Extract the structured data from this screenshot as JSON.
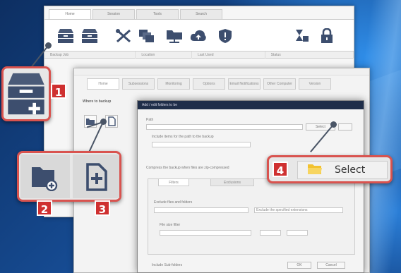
{
  "main_window": {
    "tabs": [
      "Home",
      "Session",
      "Tools",
      "Search"
    ],
    "columns": [
      "Backup Job",
      "Location",
      "Last Used",
      "Status"
    ]
  },
  "backup_window": {
    "tabs": [
      "Home",
      "Subsessions",
      "Monitoring",
      "Options",
      "Email Notifications",
      "Other Computer",
      "Version"
    ],
    "section_label": "Where to backup"
  },
  "dialog": {
    "title": "Add / edit folders to be",
    "path_label": "Path",
    "description_label": "Include items for the path to the backup",
    "browse_button_label": "Select",
    "checkbox_label": "Compress the backup when files are zip-compressed",
    "group_tabs": [
      "Filters",
      "Exclusions"
    ],
    "filter_label": "Exclude files and folders",
    "filter_value": "Exclude the specified extensions",
    "size_label": "File size filter",
    "recurse_label": "Include Sub-folders",
    "ok_label": "OK",
    "cancel_label": "Cancel"
  },
  "callouts": {
    "badge_1": "1",
    "badge_2": "2",
    "badge_3": "3",
    "badge_4": "4",
    "select_label": "Select"
  },
  "colors": {
    "accent_red": "#cf3030",
    "icon_blue": "#3d4e6e",
    "folder_yellow": "#f2c230"
  }
}
